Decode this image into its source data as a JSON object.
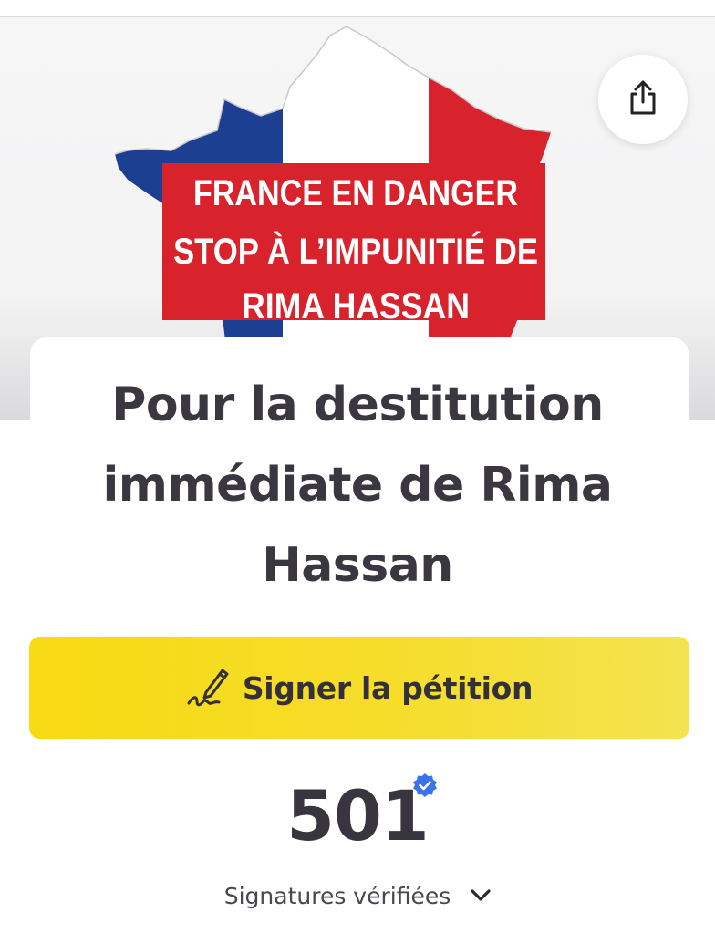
{
  "hero": {
    "banner_lines": [
      "FRANCE EN DANGER",
      "STOP À L’IMPUNITIÉ DE",
      "RIMA HASSAN"
    ],
    "flag_colors": {
      "blue": "#1d3f91",
      "white": "#ffffff",
      "red": "#d8222c"
    }
  },
  "share": {
    "icon": "share-icon"
  },
  "petition": {
    "title": "Pour la destitution immédiate de Rima Hassan"
  },
  "sign_button": {
    "label": "Signer la pétition",
    "icon": "pen-signature-icon",
    "color": "#f7da12"
  },
  "signatures": {
    "count": "501",
    "label": "Signatures vérifiées",
    "verified_icon": "verified-badge-icon",
    "verified_color": "#3b73e8"
  }
}
